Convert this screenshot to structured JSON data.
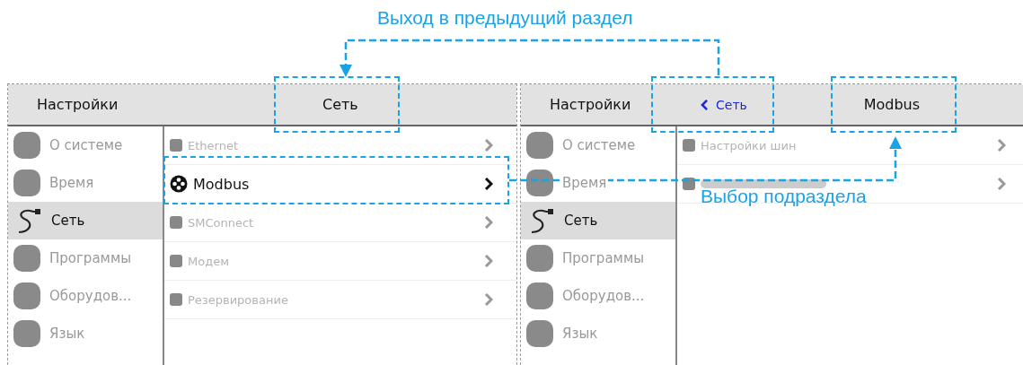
{
  "annotations": {
    "top_label": "Выход в предыдущий раздел",
    "side_label": "Выбор подраздела"
  },
  "screens": [
    {
      "title": "Настройки",
      "nav": [
        {
          "kind": "title",
          "text": "Сеть"
        }
      ],
      "sidebar": [
        {
          "label": "О системе",
          "selected": false,
          "dimmed": true
        },
        {
          "label": "Время",
          "selected": false,
          "dimmed": true
        },
        {
          "label": "Сеть",
          "selected": true,
          "dimmed": false
        },
        {
          "label": "Программы",
          "selected": false,
          "dimmed": true
        },
        {
          "label": "Оборудов...",
          "selected": false,
          "dimmed": true
        },
        {
          "label": "Язык",
          "selected": false,
          "dimmed": true
        }
      ],
      "list": [
        {
          "label": "Ethernet",
          "dimmed": true
        },
        {
          "label": "Modbus",
          "dimmed": false
        },
        {
          "label": "SMConnect",
          "dimmed": true
        },
        {
          "label": "Модем",
          "dimmed": true
        },
        {
          "label": "Резервирование",
          "dimmed": true
        }
      ]
    },
    {
      "title": "Настройки",
      "nav": [
        {
          "kind": "back",
          "text": "Сеть"
        },
        {
          "kind": "title",
          "text": "Modbus"
        }
      ],
      "sidebar": [
        {
          "label": "О системе",
          "selected": false,
          "dimmed": true
        },
        {
          "label": "Время",
          "selected": false,
          "dimmed": true
        },
        {
          "label": "Сеть",
          "selected": true,
          "dimmed": false
        },
        {
          "label": "Программы",
          "selected": false,
          "dimmed": true
        },
        {
          "label": "Оборудов...",
          "selected": false,
          "dimmed": true
        },
        {
          "label": "Язык",
          "selected": false,
          "dimmed": true
        }
      ],
      "list": [
        {
          "label": "Настройки шин",
          "dimmed": true
        }
      ]
    }
  ]
}
